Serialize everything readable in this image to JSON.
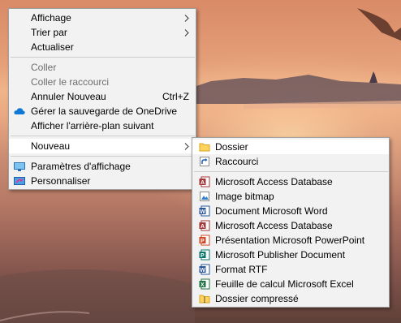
{
  "context_menu": {
    "items": [
      {
        "label": "Affichage"
      },
      {
        "label": "Trier par"
      },
      {
        "label": "Actualiser"
      },
      {
        "label": "Coller"
      },
      {
        "label": "Coller le raccourci"
      },
      {
        "label": "Annuler Nouveau",
        "shortcut": "Ctrl+Z"
      },
      {
        "label": "Gérer la sauvegarde de OneDrive",
        "icon": "onedrive-cloud-icon"
      },
      {
        "label": "Afficher l'arrière-plan suivant"
      },
      {
        "label": "Nouveau"
      },
      {
        "label": "Paramètres d'affichage",
        "icon": "display-settings-icon"
      },
      {
        "label": "Personnaliser",
        "icon": "personalize-icon"
      }
    ]
  },
  "new_submenu": {
    "items": [
      {
        "label": "Dossier",
        "icon": "folder-icon"
      },
      {
        "label": "Raccourci",
        "icon": "shortcut-icon"
      },
      {
        "label": "Microsoft Access Database",
        "icon": "access-icon"
      },
      {
        "label": "Image bitmap",
        "icon": "bitmap-icon"
      },
      {
        "label": "Document Microsoft Word",
        "icon": "word-icon"
      },
      {
        "label": "Microsoft Access Database",
        "icon": "access-icon"
      },
      {
        "label": "Présentation Microsoft PowerPoint",
        "icon": "powerpoint-icon"
      },
      {
        "label": "Microsoft Publisher Document",
        "icon": "publisher-icon"
      },
      {
        "label": "Format RTF",
        "icon": "rtf-icon"
      },
      {
        "label": "Feuille de calcul Microsoft Excel",
        "icon": "excel-icon"
      },
      {
        "label": "Dossier compressé",
        "icon": "zip-folder-icon"
      }
    ]
  },
  "colors": {
    "menu_bg": "#f2f2f2",
    "hover_bg": "#ffffff",
    "disabled_text": "#6d6d6d",
    "word": "#2b579a",
    "excel": "#217346",
    "powerpoint": "#d24726",
    "access": "#a4373a",
    "publisher": "#077568",
    "onedrive": "#0f78d4"
  }
}
